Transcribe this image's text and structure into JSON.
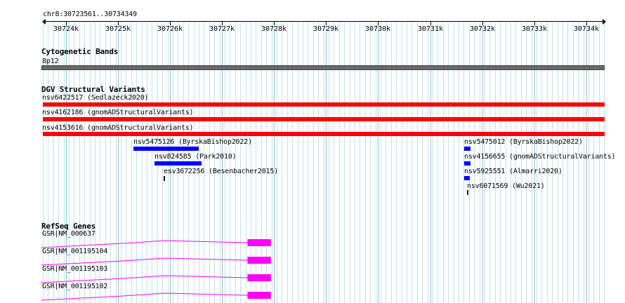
{
  "region": "chr8:30723561..30734349",
  "ruler": {
    "start": 30723561,
    "end": 30734349,
    "tick_labels": [
      "30724k",
      "30725k",
      "30726k",
      "30727k",
      "30728k",
      "30729k",
      "30730k",
      "30731k",
      "30732k",
      "30733k",
      "30734k"
    ],
    "tick_positions_bp": [
      30724000,
      30725000,
      30726000,
      30727000,
      30728000,
      30729000,
      30730000,
      30731000,
      30732000,
      30733000,
      30734000
    ]
  },
  "cytoband_track": {
    "title": "Cytogenetic Bands",
    "band_label": "8p12",
    "color": "#696969"
  },
  "dgv_track": {
    "title": "DGV Structural Variants",
    "features": [
      {
        "label": "nsv6422517 (Sedlazeck2020)",
        "start": 30723561,
        "end": 30734349,
        "color": "#ff0000"
      },
      {
        "label": "nsv4162186 (gnomADStructuralVariants)",
        "start": 30723561,
        "end": 30734349,
        "color": "#ff0000"
      },
      {
        "label": "nsv4153616 (gnomADStructuralVariants)",
        "start": 30723561,
        "end": 30734349,
        "color": "#ff0000"
      },
      {
        "label": "nsv5475126 (ByrskaBishop2022)",
        "start": 30725300,
        "end": 30726550,
        "color": "#0000ff"
      },
      {
        "label": "nsv824585 (Park2010)",
        "start": 30725700,
        "end": 30726600,
        "color": "#0000ff"
      },
      {
        "label": "esv3672256 (Besenbacher2015)",
        "start": 30725880,
        "end": 30725910,
        "color": "#000000"
      },
      {
        "label": "nsv5475012 (ByrskaBishop2022)",
        "start": 30731650,
        "end": 30731770,
        "color": "#0000ff"
      },
      {
        "label": "nsv4156655 (gnomADStructuralVariants)",
        "start": 30731650,
        "end": 30731770,
        "color": "#0000ff"
      },
      {
        "label": "nsv5925551 (Almarri2020)",
        "start": 30731650,
        "end": 30731760,
        "color": "#0000ff"
      },
      {
        "label": "nsv6071569 (Wu2021)",
        "start": 30731700,
        "end": 30731730,
        "color": "#0000ff"
      }
    ]
  },
  "refseq_track": {
    "title": "RefSeq Genes",
    "color": "#ff00ff",
    "genes": [
      {
        "label": "GSR|NM_000637",
        "exon_start": 30727490,
        "exon_end": 30727940
      },
      {
        "label": "GSR|NM_001195104",
        "exon_start": 30727490,
        "exon_end": 30727940
      },
      {
        "label": "GSR|NM_001195103",
        "exon_start": 30727490,
        "exon_end": 30727940
      },
      {
        "label": "GSR|NM_001195102",
        "exon_start": 30727490,
        "exon_end": 30727940
      }
    ]
  }
}
